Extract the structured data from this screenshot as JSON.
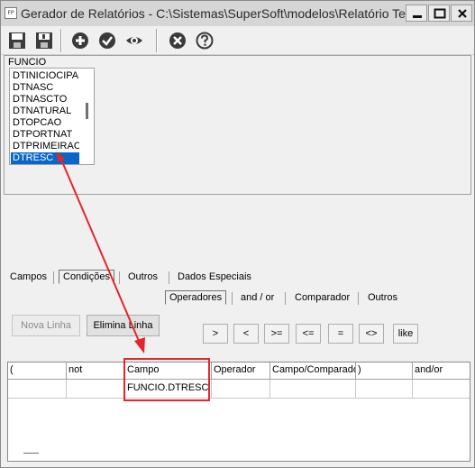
{
  "window": {
    "title": "Gerador de Relatórios - C:\\Sistemas\\SuperSoft\\modelos\\Relatório Test...",
    "app_icon_text": "FP",
    "controls": [
      "minimize-icon",
      "maximize-icon",
      "close-icon"
    ]
  },
  "toolbar": {
    "icons": [
      "save-icon",
      "save-as-icon",
      "add-icon",
      "check-icon",
      "preview-icon",
      "cancel-icon",
      "help-icon"
    ]
  },
  "fields_panel": {
    "table_name": "FUNCIO",
    "fields": [
      "DTINICIOCIPA",
      "DTNASC",
      "DTNASCTO",
      "DTNATURAL",
      "DTOPCAO",
      "DTPORTNAT",
      "DTPRIMEIRACN",
      "DTRESC"
    ],
    "selected_field": "DTRESC"
  },
  "main_tabs": {
    "campos": "Campos",
    "condicoes": "Condições",
    "outros": "Outros",
    "dados_especiais": "Dados Especiais",
    "active": "Condições"
  },
  "sub_tabs": {
    "operadores": "Operadores",
    "and_or": "and / or",
    "comparador": "Comparador",
    "outros": "Outros",
    "active": "Operadores"
  },
  "buttons": {
    "nova_linha": "Nova Linha",
    "elimina_linha": "Elimina Linha"
  },
  "operators": [
    ">",
    "<",
    ">=",
    "<=",
    "=",
    "<>",
    "like"
  ],
  "grid": {
    "columns": [
      "(",
      "not",
      "Campo",
      "Operador",
      "Campo/Comparador",
      ")",
      "and/or"
    ],
    "rows": [
      [
        "",
        "",
        "FUNCIO.DTRESC",
        "",
        "",
        "",
        ""
      ]
    ]
  },
  "annotation": {
    "color": "#e3262b"
  }
}
